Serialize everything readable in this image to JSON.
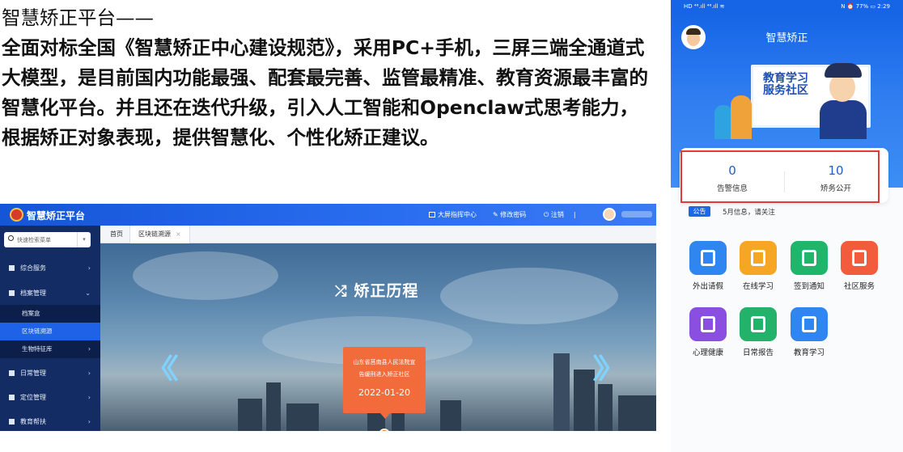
{
  "intro": {
    "heading": "智慧矫正平台——",
    "body": "全面对标全国《智慧矫正中心建设规范》，采用PC+手机，三屏三端全通道式大模型，是目前国内功能最强、配套最完善、监管最精准、教育资源最丰富的智慧化平台。并且还在迭代升级，引入人工智能和Openclaw式思考能力，根据矫正对象表现，提供智慧化、个性化矫正建议。"
  },
  "desktop": {
    "app_title": "智慧矫正平台",
    "top_actions": {
      "dashboard": "大屏指挥中心",
      "change_password": "修改密码",
      "logout": "注销"
    },
    "search": {
      "placeholder": "快速检索菜单"
    },
    "sidebar": {
      "comprehensive": "综合服务",
      "archives": "档案管理",
      "archives_box": "档案盒",
      "blockchain": "区块链溯源",
      "biometrics": "生物特征库",
      "daily": "日常管理",
      "location": "定位管理",
      "education": "教育帮扶"
    },
    "tabs": {
      "home": "首页",
      "blockchain": "区块链溯源",
      "close": "×"
    },
    "hero": {
      "title": "矫正历程",
      "arrow_left": "〈〈",
      "arrow_right": "〉〉",
      "event_line1": "山东省莒南县人民法院宣",
      "event_line2": "告缓刑进入矫正社区",
      "event_date": "2022-01-20"
    },
    "colors": {
      "topbar": "#2a6ef0",
      "sidebar": "#132c63",
      "active": "#1f62e8",
      "event": "#f26b3a"
    }
  },
  "mobile": {
    "status_left": "HD ⁴⁶.ıll ⁴⁶.ıll ≋",
    "status_right": "N ⏰ 77% ▭ 2:29",
    "title": "智慧矫正",
    "banner_text_1": "教育学习",
    "banner_text_2": "服务社区",
    "stats": [
      {
        "value": "0",
        "label": "告警信息"
      },
      {
        "value": "10",
        "label": "矫务公开"
      }
    ],
    "notice": {
      "tag": "公告",
      "text": "5月信息，请关注"
    },
    "tiles": [
      {
        "label": "外出请假",
        "color": "#2f86f0",
        "icon": "running-person-icon"
      },
      {
        "label": "在线学习",
        "color": "#f5a623",
        "icon": "reading-icon"
      },
      {
        "label": "签到通知",
        "color": "#1fb56b",
        "icon": "checkin-icon"
      },
      {
        "label": "社区服务",
        "color": "#f25b3c",
        "icon": "heart-chat-icon"
      },
      {
        "label": "心理健康",
        "color": "#8a4fe0",
        "icon": "medical-kit-icon"
      },
      {
        "label": "日常报告",
        "color": "#22b26a",
        "icon": "report-icon"
      },
      {
        "label": "教育学习",
        "color": "#2f86f0",
        "icon": "graduation-cap-icon"
      }
    ],
    "colors": {
      "header": "#1565e6",
      "highlight_box": "#e53935"
    }
  }
}
